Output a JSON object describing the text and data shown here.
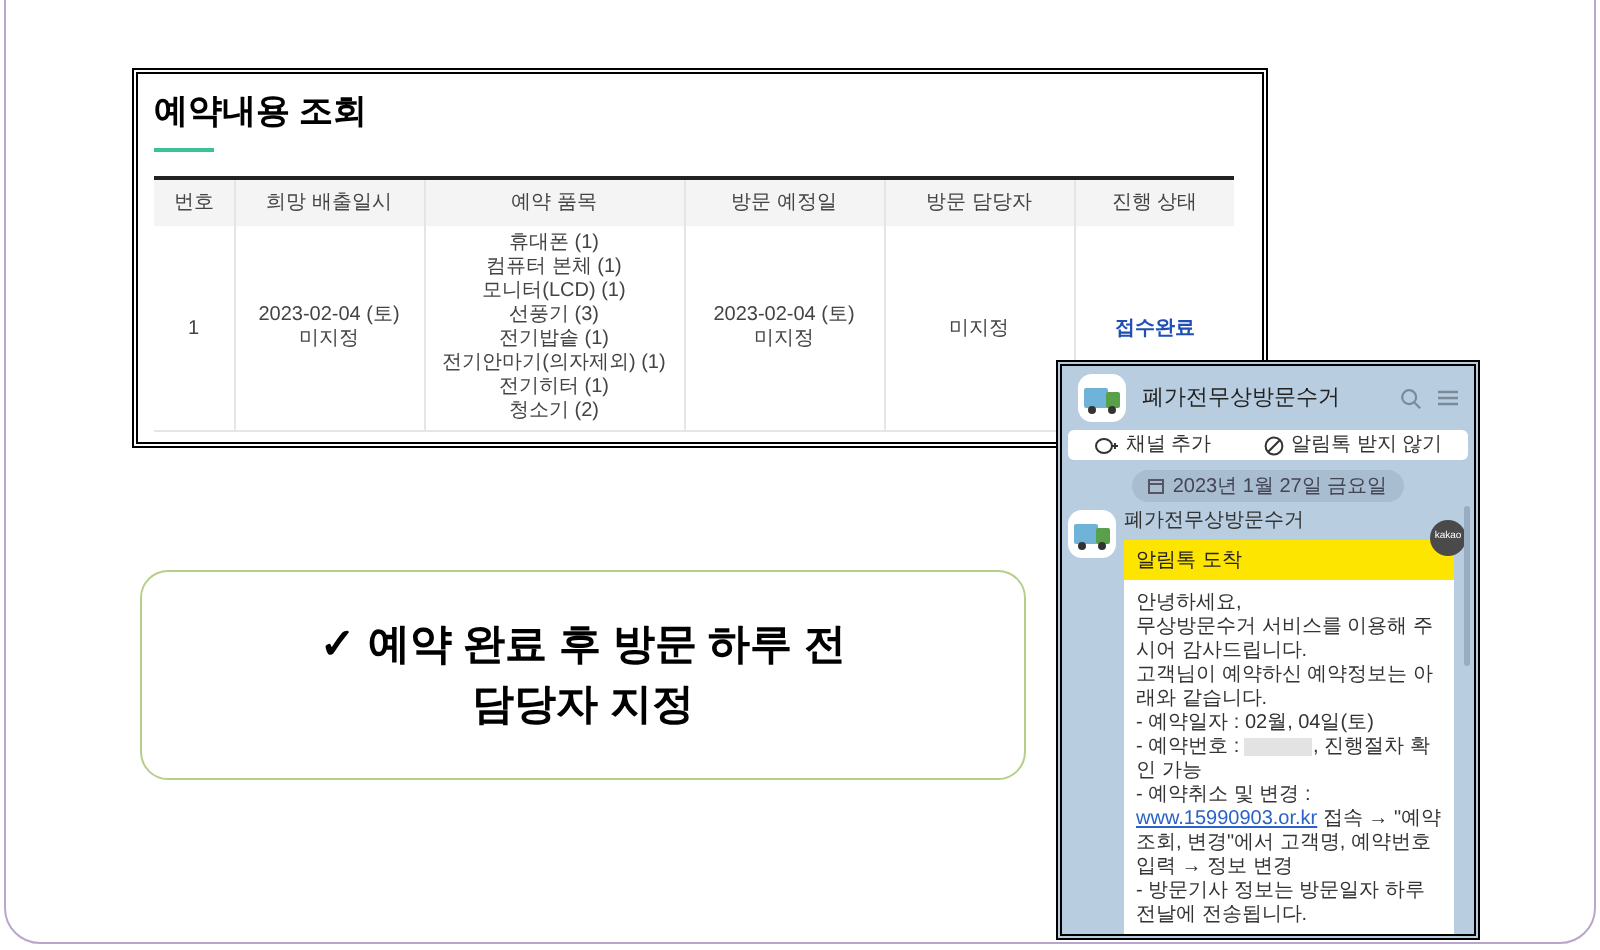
{
  "panel": {
    "title": "예약내용 조회",
    "columns": [
      "번호",
      "희망 배출일시",
      "예약 품목",
      "방문 예정일",
      "방문 담당자",
      "진행 상태"
    ],
    "rows": [
      {
        "number": "1",
        "pickup": [
          "2023-02-04 (토)",
          "미지정"
        ],
        "items": [
          "휴대폰 (1)",
          "컴퓨터 본체 (1)",
          "모니터(LCD) (1)",
          "선풍기 (3)",
          "전기밥솥 (1)",
          "전기안마기(의자제외) (1)",
          "전기히터 (1)",
          "청소기 (2)"
        ],
        "visit_date": [
          "2023-02-04 (토)",
          "미지정"
        ],
        "staff": "미지정",
        "status": "접수완료"
      }
    ]
  },
  "callout": {
    "lines": [
      "✓ 예약 완료 후 방문 하루 전",
      "담당자 지정"
    ]
  },
  "chat": {
    "channel_name": "폐가전무상방문수거",
    "actions": [
      "채널 추가",
      "알림톡 받지 않기"
    ],
    "date": "2023년 1월 27일 금요일",
    "sender": "폐가전무상방문수거",
    "badge": "kakao",
    "message_title": "알림톡 도착",
    "paragraphs": [
      {
        "kind": "text",
        "text": "안녕하세요,"
      },
      {
        "kind": "text",
        "text": "무상방문수거 서비스를 이용해 주시어 감사드립니다."
      },
      {
        "kind": "text",
        "text": "고객님이 예약하신 예약정보는 아래와 같습니다."
      },
      {
        "kind": "text",
        "text": "- 예약일자 : 02월, 04일(토)"
      },
      {
        "kind": "redacted",
        "before": "- 예약번호 :",
        "after": ", 진행절차 확인 가능"
      },
      {
        "kind": "text",
        "text": "- 예약취소 및 변경 :"
      },
      {
        "kind": "link",
        "link": "www.15990903.or.kr",
        "after": " 접속 → \"예약조회, 변경\"에서 고객명, 예약번호 입력 → 정보 변경"
      },
      {
        "kind": "text",
        "text": "- 방문기사 정보는 방문일자 하루 전날에 전송됩니다."
      }
    ]
  }
}
